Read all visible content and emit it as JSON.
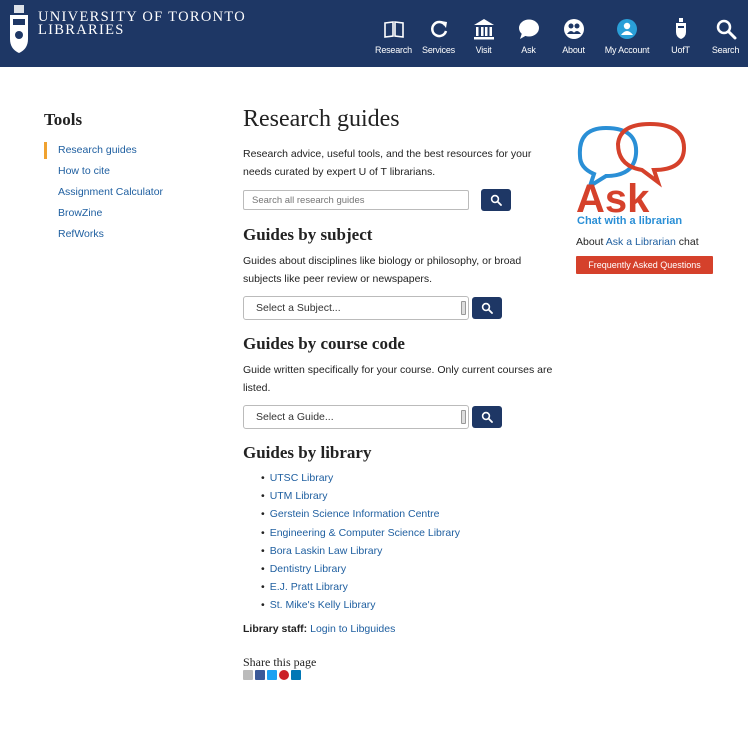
{
  "header": {
    "logo_line1": "UNIVERSITY OF TORONTO",
    "logo_line2": "LIBRARIES",
    "nav": [
      {
        "label": "Research",
        "icon": "book-icon"
      },
      {
        "label": "Services",
        "icon": "refresh-icon"
      },
      {
        "label": "Visit",
        "icon": "building-icon"
      },
      {
        "label": "Ask",
        "icon": "chat-bubble-icon"
      },
      {
        "label": "About",
        "icon": "people-icon"
      },
      {
        "label": "My Account",
        "icon": "user-icon"
      },
      {
        "label": "UofT",
        "icon": "crest-icon"
      },
      {
        "label": "Search",
        "icon": "search-icon"
      }
    ]
  },
  "sidebar": {
    "title": "Tools",
    "items": [
      {
        "label": "Research guides"
      },
      {
        "label": "How to cite"
      },
      {
        "label": "Assignment Calculator"
      },
      {
        "label": "BrowZine"
      },
      {
        "label": "RefWorks"
      }
    ]
  },
  "main": {
    "title": "Research guides",
    "intro": "Research advice, useful tools, and the best resources for your needs curated by expert U of T librarians.",
    "search_placeholder": "Search all research guides",
    "subject": {
      "title": "Guides by subject",
      "desc": "Guides about disciplines like biology or philosophy, or broad subjects like peer review or newspapers.",
      "select_value": "Select a Subject..."
    },
    "course": {
      "title": "Guides by course code",
      "desc": "Guide written specifically for your course.  Only current courses are listed.",
      "select_value": "Select a Guide..."
    },
    "library": {
      "title": "Guides by library",
      "items": [
        "UTSC Library",
        "UTM Library",
        "Gerstein Science Information Centre",
        "Engineering & Computer Science Library",
        "Bora Laskin Law Library",
        "Dentistry Library",
        "E.J. Pratt Library",
        "St. Mike's Kelly Library"
      ]
    },
    "staff_label": "Library staff:",
    "staff_link": "Login to Libguides",
    "share_title": "Share this page"
  },
  "ask": {
    "logo_word": "Ask",
    "logo_tagline": "Chat with a librarian",
    "about_prefix": "About",
    "about_link": "Ask a Librarian",
    "about_suffix": "chat",
    "faq_label": "Frequently Asked Questions"
  },
  "colors": {
    "header_bg": "#1e3765",
    "link": "#1f5fa0",
    "accent_orange": "#f0a230",
    "ask_red": "#d5412b",
    "ask_blue": "#2a8fd6"
  }
}
